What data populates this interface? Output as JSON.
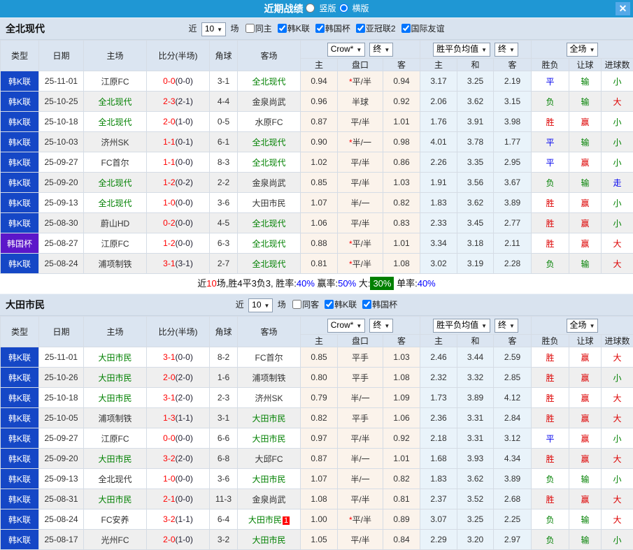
{
  "titlebar": {
    "title": "近期战绩",
    "radio_vertical": "竖版",
    "radio_horizontal": "横版",
    "close": "✕"
  },
  "table_header": {
    "col_type": "类型",
    "col_date": "日期",
    "col_home": "主场",
    "col_score": "比分(半场)",
    "col_corner": "角球",
    "col_away": "客场",
    "sel_company": "Crow*",
    "sel_final1": "终",
    "sel_avg": "胜平负均值",
    "sel_final2": "终",
    "sel_full": "全场",
    "sub_home": "主",
    "sub_handicap": "盘口",
    "sub_away": "客",
    "sub_avg_home": "主",
    "sub_avg_draw": "和",
    "sub_avg_away": "客",
    "sub_wdl": "胜负",
    "sub_let": "让球",
    "sub_goals": "进球数"
  },
  "colors": {
    "topbar": "#1f97d4",
    "league_blue": "#1547c6",
    "cup_purple": "#5c17c9",
    "win_red": "#dd0000",
    "lose_green": "#008000",
    "draw_blue": "#0000ee"
  },
  "sections": [
    {
      "team": "全北现代",
      "filter": {
        "near": "近",
        "select": "10",
        "games": "场",
        "same": "同主",
        "leagues": [
          "韩K联",
          "韩国杯",
          "亚冠联2",
          "国际友谊"
        ]
      },
      "summary": {
        "t1": "近",
        "t2": "10",
        "t3": "场,胜4平3负3, 胜率:",
        "t4": "40%",
        "t5": "赢率:",
        "t6": "50%",
        "t7": "大:",
        "t8": "30%",
        "t9": "单率:",
        "t10": "40%"
      },
      "rows": [
        {
          "type": "韩K联",
          "tc": "blue",
          "date": "25-11-01",
          "home": "江原FC",
          "hg": false,
          "ft": "0-0",
          "ht": "(0-0)",
          "corner": "3-1",
          "away": "全北现代",
          "ag": true,
          "badge": "",
          "o1": "0.94",
          "star": true,
          "pan": "平/半",
          "o2": "0.94",
          "a1": "3.17",
          "a2": "3.25",
          "a3": "2.19",
          "r1": "平",
          "c1": "blue",
          "r2": "输",
          "c2": "green",
          "r3": "小",
          "c3": "green"
        },
        {
          "type": "韩K联",
          "tc": "blue",
          "date": "25-10-25",
          "home": "全北现代",
          "hg": true,
          "ft": "2-3",
          "ht": "(2-1)",
          "corner": "4-4",
          "away": "金泉尚武",
          "ag": false,
          "badge": "",
          "o1": "0.96",
          "star": false,
          "pan": "半球",
          "o2": "0.92",
          "a1": "2.06",
          "a2": "3.62",
          "a3": "3.15",
          "r1": "负",
          "c1": "green",
          "r2": "输",
          "c2": "green",
          "r3": "大",
          "c3": "red"
        },
        {
          "type": "韩K联",
          "tc": "blue",
          "date": "25-10-18",
          "home": "全北现代",
          "hg": true,
          "ft": "2-0",
          "ht": "(1-0)",
          "corner": "0-5",
          "away": "水原FC",
          "ag": false,
          "badge": "",
          "o1": "0.87",
          "star": false,
          "pan": "平/半",
          "o2": "1.01",
          "a1": "1.76",
          "a2": "3.91",
          "a3": "3.98",
          "r1": "胜",
          "c1": "red",
          "r2": "赢",
          "c2": "red",
          "r3": "小",
          "c3": "green"
        },
        {
          "type": "韩K联",
          "tc": "blue",
          "date": "25-10-03",
          "home": "济州SK",
          "hg": false,
          "ft": "1-1",
          "ht": "(0-1)",
          "corner": "6-1",
          "away": "全北现代",
          "ag": true,
          "badge": "",
          "o1": "0.90",
          "star": true,
          "pan": "半/一",
          "o2": "0.98",
          "a1": "4.01",
          "a2": "3.78",
          "a3": "1.77",
          "r1": "平",
          "c1": "blue",
          "r2": "输",
          "c2": "green",
          "r3": "小",
          "c3": "green"
        },
        {
          "type": "韩K联",
          "tc": "blue",
          "date": "25-09-27",
          "home": "FC首尔",
          "hg": false,
          "ft": "1-1",
          "ht": "(0-0)",
          "corner": "8-3",
          "away": "全北现代",
          "ag": true,
          "badge": "",
          "o1": "1.02",
          "star": false,
          "pan": "平/半",
          "o2": "0.86",
          "a1": "2.26",
          "a2": "3.35",
          "a3": "2.95",
          "r1": "平",
          "c1": "blue",
          "r2": "赢",
          "c2": "red",
          "r3": "小",
          "c3": "green"
        },
        {
          "type": "韩K联",
          "tc": "blue",
          "date": "25-09-20",
          "home": "全北现代",
          "hg": true,
          "ft": "1-2",
          "ht": "(0-2)",
          "corner": "2-2",
          "away": "金泉尚武",
          "ag": false,
          "badge": "",
          "o1": "0.85",
          "star": false,
          "pan": "平/半",
          "o2": "1.03",
          "a1": "1.91",
          "a2": "3.56",
          "a3": "3.67",
          "r1": "负",
          "c1": "green",
          "r2": "输",
          "c2": "green",
          "r3": "走",
          "c3": "blue"
        },
        {
          "type": "韩K联",
          "tc": "blue",
          "date": "25-09-13",
          "home": "全北现代",
          "hg": true,
          "ft": "1-0",
          "ht": "(0-0)",
          "corner": "3-6",
          "away": "大田市民",
          "ag": false,
          "badge": "",
          "o1": "1.07",
          "star": false,
          "pan": "半/一",
          "o2": "0.82",
          "a1": "1.83",
          "a2": "3.62",
          "a3": "3.89",
          "r1": "胜",
          "c1": "red",
          "r2": "赢",
          "c2": "red",
          "r3": "小",
          "c3": "green"
        },
        {
          "type": "韩K联",
          "tc": "blue",
          "date": "25-08-30",
          "home": "蔚山HD",
          "hg": false,
          "ft": "0-2",
          "ht": "(0-0)",
          "corner": "4-5",
          "away": "全北现代",
          "ag": true,
          "badge": "",
          "o1": "1.06",
          "star": false,
          "pan": "平/半",
          "o2": "0.83",
          "a1": "2.33",
          "a2": "3.45",
          "a3": "2.77",
          "r1": "胜",
          "c1": "red",
          "r2": "赢",
          "c2": "red",
          "r3": "小",
          "c3": "green"
        },
        {
          "type": "韩国杯",
          "tc": "purple",
          "date": "25-08-27",
          "home": "江原FC",
          "hg": false,
          "ft": "1-2",
          "ht": "(0-0)",
          "corner": "6-3",
          "away": "全北现代",
          "ag": true,
          "badge": "",
          "o1": "0.88",
          "star": true,
          "pan": "平/半",
          "o2": "1.01",
          "a1": "3.34",
          "a2": "3.18",
          "a3": "2.11",
          "r1": "胜",
          "c1": "red",
          "r2": "赢",
          "c2": "red",
          "r3": "大",
          "c3": "red"
        },
        {
          "type": "韩K联",
          "tc": "blue",
          "date": "25-08-24",
          "home": "浦项制铁",
          "hg": false,
          "ft": "3-1",
          "ht": "(3-1)",
          "corner": "2-7",
          "away": "全北现代",
          "ag": true,
          "badge": "",
          "o1": "0.81",
          "star": true,
          "pan": "平/半",
          "o2": "1.08",
          "a1": "3.02",
          "a2": "3.19",
          "a3": "2.28",
          "r1": "负",
          "c1": "green",
          "r2": "输",
          "c2": "green",
          "r3": "大",
          "c3": "red"
        }
      ]
    },
    {
      "team": "大田市民",
      "filter": {
        "near": "近",
        "select": "10",
        "games": "场",
        "same": "同客",
        "leagues": [
          "韩K联",
          "韩国杯"
        ]
      },
      "rows": [
        {
          "type": "韩K联",
          "tc": "blue",
          "date": "25-11-01",
          "home": "大田市民",
          "hg": true,
          "ft": "3-1",
          "ht": "(0-0)",
          "corner": "8-2",
          "away": "FC首尔",
          "ag": false,
          "badge": "",
          "o1": "0.85",
          "star": false,
          "pan": "平手",
          "o2": "1.03",
          "a1": "2.46",
          "a2": "3.44",
          "a3": "2.59",
          "r1": "胜",
          "c1": "red",
          "r2": "赢",
          "c2": "red",
          "r3": "大",
          "c3": "red"
        },
        {
          "type": "韩K联",
          "tc": "blue",
          "date": "25-10-26",
          "home": "大田市民",
          "hg": true,
          "ft": "2-0",
          "ht": "(2-0)",
          "corner": "1-6",
          "away": "浦项制铁",
          "ag": false,
          "badge": "",
          "o1": "0.80",
          "star": false,
          "pan": "平手",
          "o2": "1.08",
          "a1": "2.32",
          "a2": "3.32",
          "a3": "2.85",
          "r1": "胜",
          "c1": "red",
          "r2": "赢",
          "c2": "red",
          "r3": "小",
          "c3": "green"
        },
        {
          "type": "韩K联",
          "tc": "blue",
          "date": "25-10-18",
          "home": "大田市民",
          "hg": true,
          "ft": "3-1",
          "ht": "(2-0)",
          "corner": "2-3",
          "away": "济州SK",
          "ag": false,
          "badge": "",
          "o1": "0.79",
          "star": false,
          "pan": "半/一",
          "o2": "1.09",
          "a1": "1.73",
          "a2": "3.89",
          "a3": "4.12",
          "r1": "胜",
          "c1": "red",
          "r2": "赢",
          "c2": "red",
          "r3": "大",
          "c3": "red"
        },
        {
          "type": "韩K联",
          "tc": "blue",
          "date": "25-10-05",
          "home": "浦项制铁",
          "hg": false,
          "ft": "1-3",
          "ht": "(1-1)",
          "corner": "3-1",
          "away": "大田市民",
          "ag": true,
          "badge": "",
          "o1": "0.82",
          "star": false,
          "pan": "平手",
          "o2": "1.06",
          "a1": "2.36",
          "a2": "3.31",
          "a3": "2.84",
          "r1": "胜",
          "c1": "red",
          "r2": "赢",
          "c2": "red",
          "r3": "大",
          "c3": "red"
        },
        {
          "type": "韩K联",
          "tc": "blue",
          "date": "25-09-27",
          "home": "江原FC",
          "hg": false,
          "ft": "0-0",
          "ht": "(0-0)",
          "corner": "6-6",
          "away": "大田市民",
          "ag": true,
          "badge": "",
          "o1": "0.97",
          "star": false,
          "pan": "平/半",
          "o2": "0.92",
          "a1": "2.18",
          "a2": "3.31",
          "a3": "3.12",
          "r1": "平",
          "c1": "blue",
          "r2": "赢",
          "c2": "red",
          "r3": "小",
          "c3": "green"
        },
        {
          "type": "韩K联",
          "tc": "blue",
          "date": "25-09-20",
          "home": "大田市民",
          "hg": true,
          "ft": "3-2",
          "ht": "(2-0)",
          "corner": "6-8",
          "away": "大邱FC",
          "ag": false,
          "badge": "",
          "o1": "0.87",
          "star": false,
          "pan": "半/一",
          "o2": "1.01",
          "a1": "1.68",
          "a2": "3.93",
          "a3": "4.34",
          "r1": "胜",
          "c1": "red",
          "r2": "赢",
          "c2": "red",
          "r3": "大",
          "c3": "red"
        },
        {
          "type": "韩K联",
          "tc": "blue",
          "date": "25-09-13",
          "home": "全北现代",
          "hg": false,
          "ft": "1-0",
          "ht": "(0-0)",
          "corner": "3-6",
          "away": "大田市民",
          "ag": true,
          "badge": "",
          "o1": "1.07",
          "star": false,
          "pan": "半/一",
          "o2": "0.82",
          "a1": "1.83",
          "a2": "3.62",
          "a3": "3.89",
          "r1": "负",
          "c1": "green",
          "r2": "输",
          "c2": "green",
          "r3": "小",
          "c3": "green"
        },
        {
          "type": "韩K联",
          "tc": "blue",
          "date": "25-08-31",
          "home": "大田市民",
          "hg": true,
          "ft": "2-1",
          "ht": "(0-0)",
          "corner": "11-3",
          "away": "金泉尚武",
          "ag": false,
          "badge": "",
          "o1": "1.08",
          "star": false,
          "pan": "平/半",
          "o2": "0.81",
          "a1": "2.37",
          "a2": "3.52",
          "a3": "2.68",
          "r1": "胜",
          "c1": "red",
          "r2": "赢",
          "c2": "red",
          "r3": "大",
          "c3": "red"
        },
        {
          "type": "韩K联",
          "tc": "blue",
          "date": "25-08-24",
          "home": "FC安养",
          "hg": false,
          "ft": "3-2",
          "ht": "(1-1)",
          "corner": "6-4",
          "away": "大田市民",
          "ag": true,
          "badge": "1",
          "o1": "1.00",
          "star": true,
          "pan": "平/半",
          "o2": "0.89",
          "a1": "3.07",
          "a2": "3.25",
          "a3": "2.25",
          "r1": "负",
          "c1": "green",
          "r2": "输",
          "c2": "green",
          "r3": "大",
          "c3": "red"
        },
        {
          "type": "韩K联",
          "tc": "blue",
          "date": "25-08-17",
          "home": "光州FC",
          "hg": false,
          "ft": "2-0",
          "ht": "(1-0)",
          "corner": "3-2",
          "away": "大田市民",
          "ag": true,
          "badge": "",
          "o1": "1.05",
          "star": false,
          "pan": "平/半",
          "o2": "0.84",
          "a1": "2.29",
          "a2": "3.20",
          "a3": "2.97",
          "r1": "负",
          "c1": "green",
          "r2": "输",
          "c2": "green",
          "r3": "小",
          "c3": "green"
        }
      ]
    }
  ]
}
